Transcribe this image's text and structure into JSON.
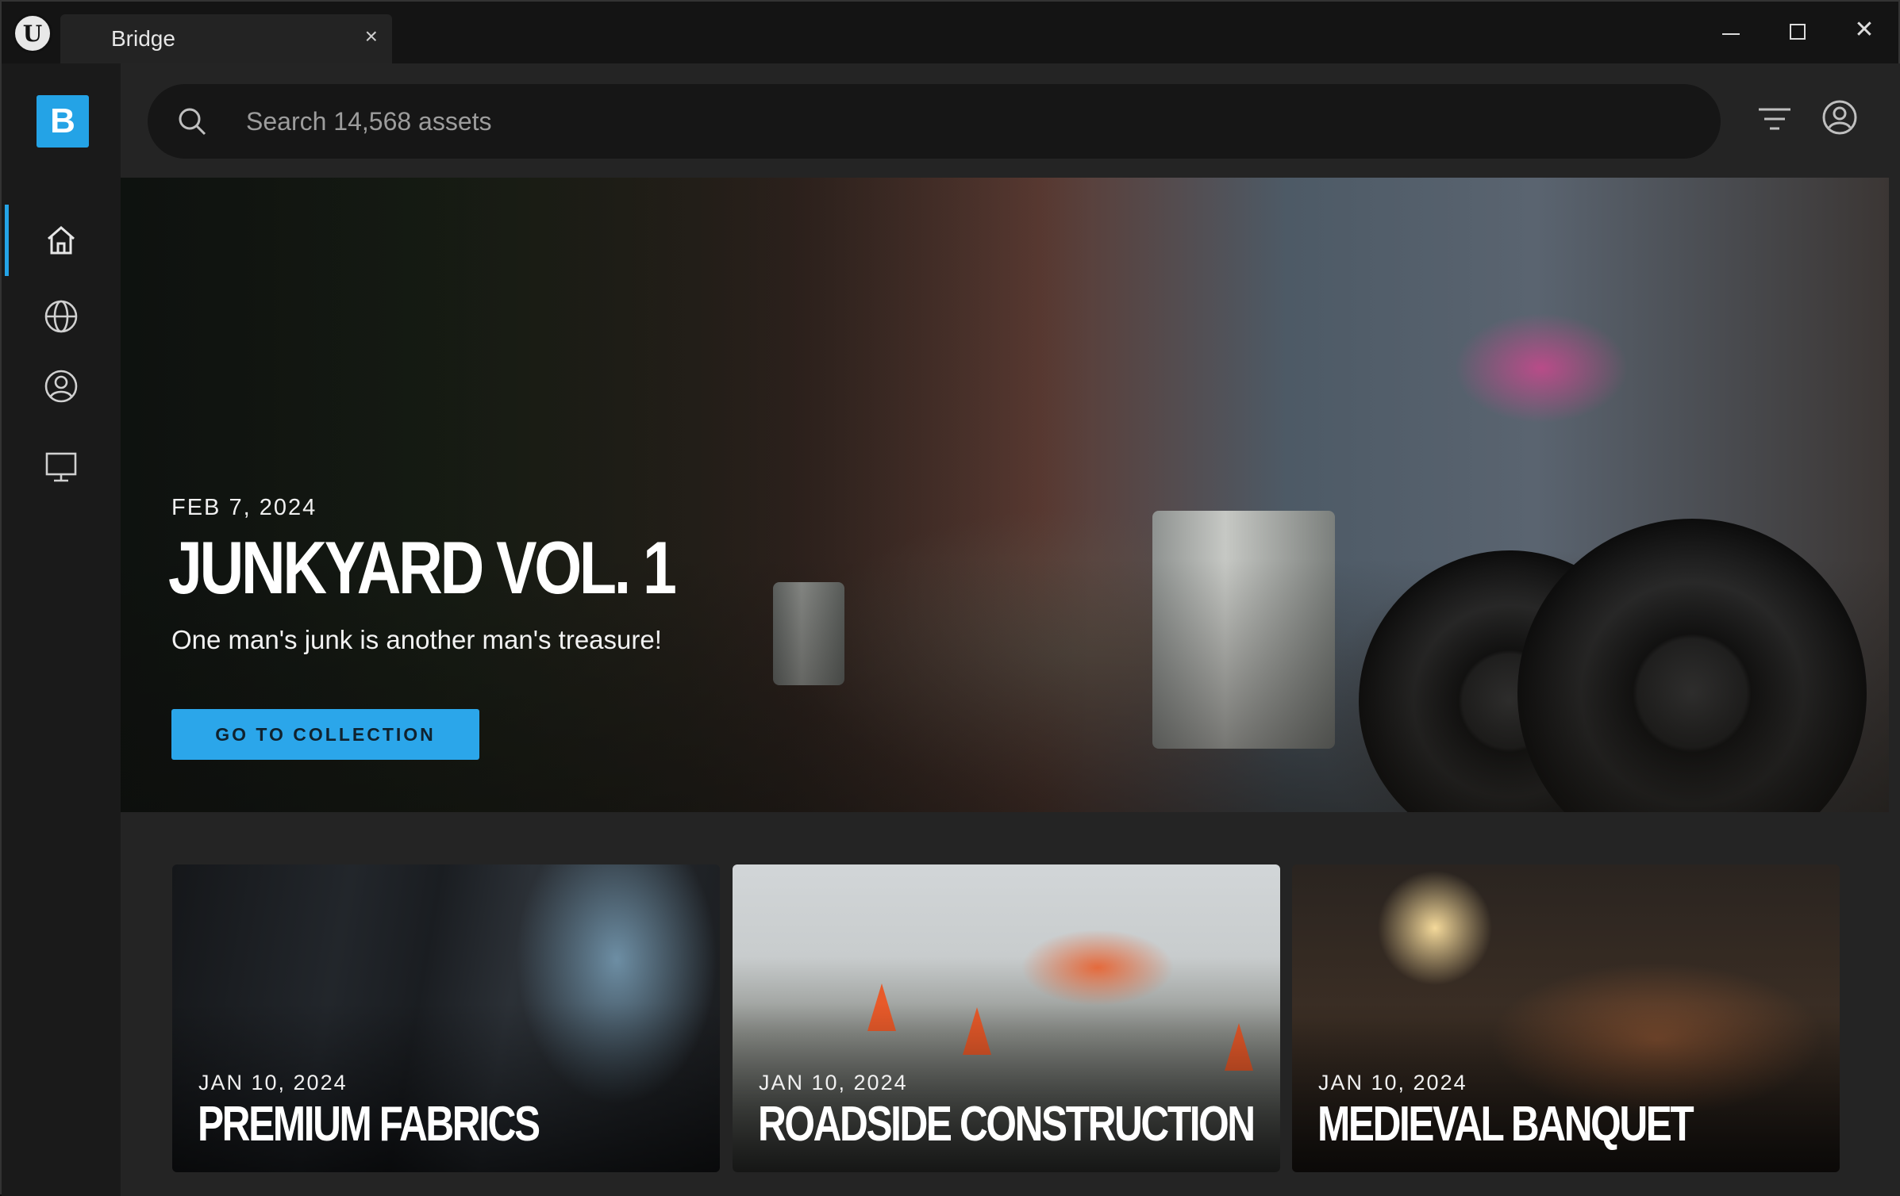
{
  "titlebar": {
    "tab_label": "Bridge",
    "tab_close": "×",
    "app_logo_letter": "U",
    "controls": {
      "close": "✕"
    }
  },
  "sidebar": {
    "logo_letter": "B",
    "items": [
      {
        "name": "home",
        "icon": "home-icon",
        "active": true
      },
      {
        "name": "globe",
        "icon": "globe-icon",
        "active": false
      },
      {
        "name": "account",
        "icon": "user-circle-icon",
        "active": false
      },
      {
        "name": "local",
        "icon": "monitor-icon",
        "active": false
      }
    ]
  },
  "search": {
    "placeholder": "Search 14,568 assets",
    "value": ""
  },
  "header_icons": [
    "filter-icon",
    "account-icon"
  ],
  "hero": {
    "date": "FEB 7, 2024",
    "title": "JUNKYARD VOL. 1",
    "subtitle": "One man's junk is another man's treasure!",
    "button_label": "GO TO COLLECTION"
  },
  "cards": [
    {
      "date": "JAN 10, 2024",
      "title": "PREMIUM FABRICS"
    },
    {
      "date": "JAN 10, 2024",
      "title": "ROADSIDE CONSTRUCTION"
    },
    {
      "date": "JAN 10, 2024",
      "title": "MEDIEVAL BANQUET"
    }
  ],
  "colors": {
    "accent": "#24a3e6",
    "button": "#2ba6ea",
    "background": "#242424",
    "sidebar": "#1a1a1a",
    "titlebar": "#141414"
  }
}
